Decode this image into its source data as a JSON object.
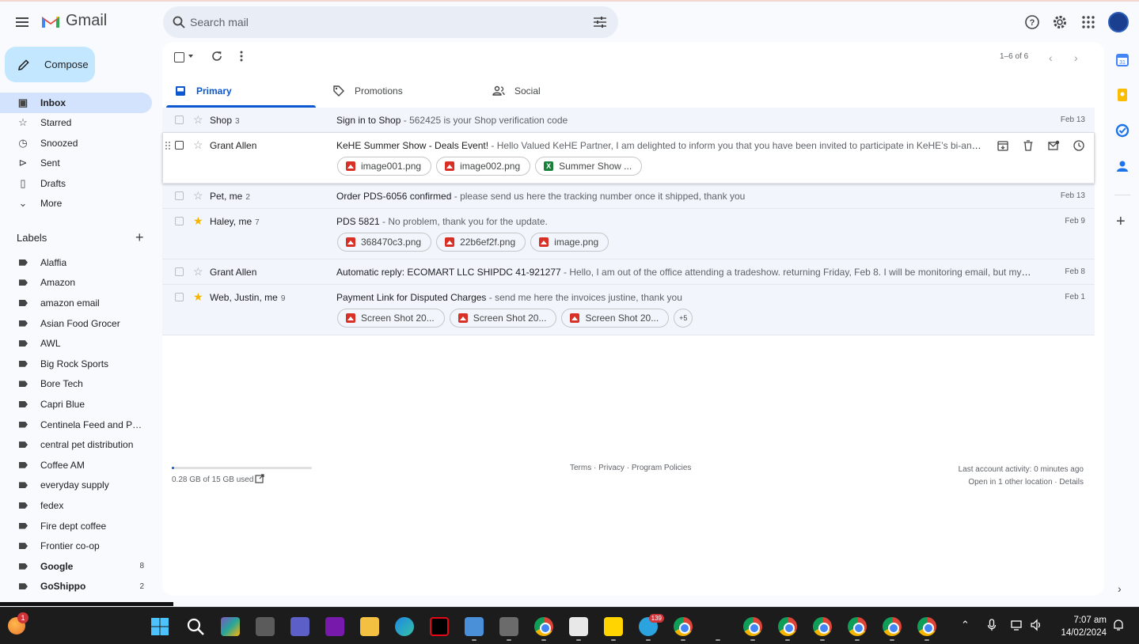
{
  "app": {
    "name": "Gmail"
  },
  "search": {
    "placeholder": "Search mail"
  },
  "compose": {
    "label": "Compose"
  },
  "nav": [
    {
      "label": "Inbox",
      "icon": "inbox-icon",
      "active": true
    },
    {
      "label": "Starred",
      "icon": "star-icon"
    },
    {
      "label": "Snoozed",
      "icon": "clock-icon"
    },
    {
      "label": "Sent",
      "icon": "send-icon"
    },
    {
      "label": "Drafts",
      "icon": "draft-icon"
    },
    {
      "label": "More",
      "icon": "chevron-down-icon"
    }
  ],
  "labels": {
    "title": "Labels",
    "add": "+",
    "items": [
      {
        "label": "Alaffia"
      },
      {
        "label": "Amazon"
      },
      {
        "label": "amazon email"
      },
      {
        "label": "Asian Food Grocer"
      },
      {
        "label": "AWL"
      },
      {
        "label": "Big Rock Sports"
      },
      {
        "label": "Bore Tech"
      },
      {
        "label": "Capri Blue"
      },
      {
        "label": "Centinela Feed and Pet ..."
      },
      {
        "label": "central pet distribution"
      },
      {
        "label": "Coffee AM"
      },
      {
        "label": "everyday supply"
      },
      {
        "label": "fedex"
      },
      {
        "label": "Fire dept coffee"
      },
      {
        "label": "Frontier co-op"
      },
      {
        "label": "Google",
        "count": "8",
        "bold": true
      },
      {
        "label": "GoShippo",
        "count": "2",
        "bold": true
      }
    ]
  },
  "toolbar": {
    "pager": "1–6 of 6"
  },
  "tabs": [
    {
      "label": "Primary",
      "icon": "inbox-icon",
      "active": true
    },
    {
      "label": "Promotions",
      "icon": "tag-icon"
    },
    {
      "label": "Social",
      "icon": "people-icon"
    }
  ],
  "emails": [
    {
      "sender": "Shop",
      "count": "3",
      "subject": "Sign in to Shop",
      "snippet": " - 562425 is your Shop verification code",
      "date": "Feb 13",
      "starred": false,
      "attachments": []
    },
    {
      "sender": "Grant Allen",
      "count": "",
      "subject": "KeHE Summer Show - Deals Event!",
      "snippet": " - Hello Valued KeHE Partner, I am delighted to inform you that you have been invited to participate in KeHE’s bi-annual digita...",
      "date": "",
      "starred": false,
      "hover": true,
      "attachments": [
        {
          "name": "image001.png",
          "type": "img"
        },
        {
          "name": "image002.png",
          "type": "img"
        },
        {
          "name": "Summer Show ...",
          "type": "xls"
        }
      ]
    },
    {
      "sender": "Pet, me",
      "count": "2",
      "subject": "Order PDS-6056 confirmed",
      "snippet": " - please send us here the tracking number once it shipped, thank you",
      "date": "Feb 13",
      "starred": false,
      "attachments": []
    },
    {
      "sender": "Haley, me",
      "count": "7",
      "subject": "PDS 5821",
      "snippet": " - No problem, thank you for the update.",
      "date": "Feb 9",
      "starred": true,
      "attachments": [
        {
          "name": "368470c3.png",
          "type": "img"
        },
        {
          "name": "22b6ef2f.png",
          "type": "img"
        },
        {
          "name": "image.png",
          "type": "img"
        }
      ]
    },
    {
      "sender": "Grant Allen",
      "count": "",
      "subject": "Automatic reply: ECOMART LLC SHIPDC 41-921277",
      "snippet": " - Hello, I am out of the office attending a tradeshow. returning Friday, Feb 8. I will be monitoring email, but my response...",
      "date": "Feb 8",
      "starred": false,
      "attachments": []
    },
    {
      "sender": "Web, Justin, me",
      "count": "9",
      "subject": "Payment Link for Disputed Charges",
      "snippet": " - send me here the invoices justine, thank you",
      "date": "Feb 1",
      "starred": true,
      "attachments": [
        {
          "name": "Screen Shot 20...",
          "type": "img"
        },
        {
          "name": "Screen Shot 20...",
          "type": "img"
        },
        {
          "name": "Screen Shot 20...",
          "type": "img"
        }
      ],
      "more": "+5"
    }
  ],
  "footer": {
    "storage": "0.28 GB of 15 GB used",
    "storage_fraction": 0.019,
    "terms": "Terms",
    "privacy": "Privacy",
    "policies": "Program Policies",
    "activity": "Last account activity: 0 minutes ago",
    "other_location": "Open in 1 other location",
    "details": "Details"
  },
  "taskbar": {
    "weather_badge": "1",
    "telegram_badge": "139",
    "time": "7:07 am",
    "date": "14/02/2024"
  },
  "colors": {
    "accent": "#0b57d0",
    "compose": "#c2e7ff",
    "active_nav": "#d3e3fd",
    "star": "#f4b400"
  }
}
